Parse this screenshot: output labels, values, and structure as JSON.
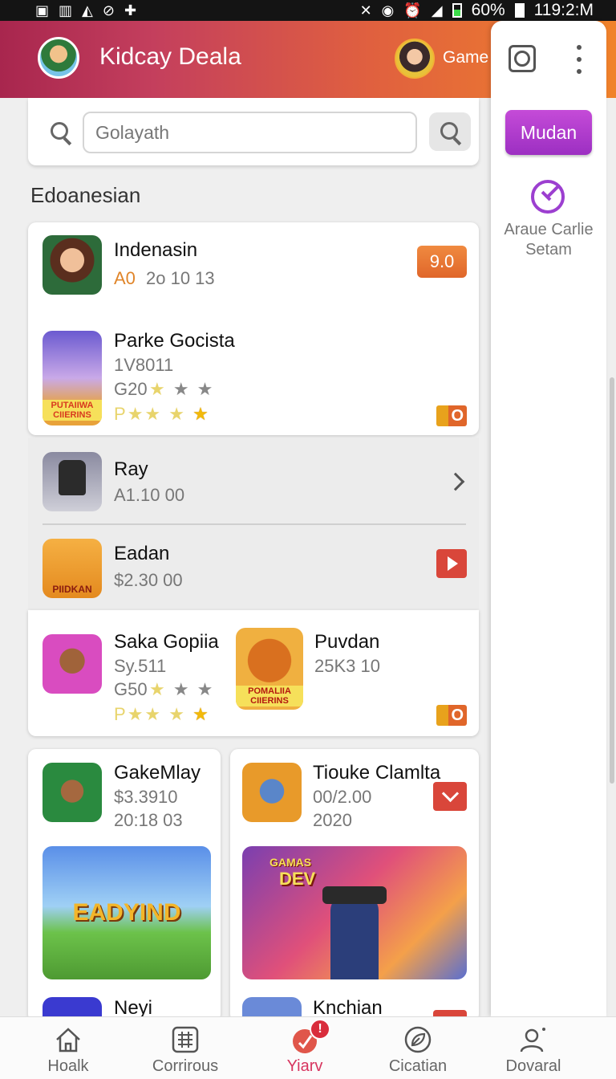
{
  "status_bar": {
    "left_icons": [
      "lock-icon",
      "sim-icon",
      "image-icon",
      "leaf-icon",
      "plus-icon"
    ],
    "right_icons": [
      "nfc-icon",
      "wifi-icon",
      "alarm-icon",
      "signal-icon",
      "battery-icon"
    ],
    "battery": "60%",
    "time": "119:2:M"
  },
  "header": {
    "title": "Kidcay Deala",
    "game_label": "Game"
  },
  "side_panel": {
    "primary_button": "Mudan",
    "caption_line1": "Araue Carlie",
    "caption_line2": "Setam"
  },
  "search": {
    "placeholder": "Golayath"
  },
  "section_title": "Edoanesian",
  "items": [
    {
      "name": "Indenasin",
      "meta_accent": "A0",
      "meta": "2o 10 13",
      "badge": "9.0"
    },
    {
      "name": "Parke Gocista",
      "line1": "1V8011",
      "line2": "G20",
      "stars_prefix": "P",
      "thumb_text": "PUTAIIWA CIIERINS",
      "mini_badge": "O"
    },
    {
      "name": "Ray",
      "meta": "A1.10 00"
    },
    {
      "name": "Eadan",
      "meta": "$2.30 00",
      "thumb_text": "PIIDKAN"
    },
    {
      "name": "Saka Gopiia",
      "line1": "Sy.511",
      "line2": "G50",
      "stars_prefix": "P"
    },
    {
      "name": "Puvdan",
      "meta": "25K3 10",
      "thumb_text": "POMALIIA CIIERINS",
      "mini_badge": "O"
    }
  ],
  "grid": [
    {
      "name": "GakeMlay",
      "line1": "$3.3910",
      "line2": "20:18 03",
      "banner_text": "EADYIND",
      "next_name": "Neyi"
    },
    {
      "name": "Tiouke Clamlta",
      "line1": "00/2.00",
      "line2": "2020",
      "banner_text": "DEV",
      "banner_sub": "GAMAS",
      "next_name": "Knchian"
    }
  ],
  "bottom_nav": [
    {
      "label": "Hoalk",
      "icon": "home-icon"
    },
    {
      "label": "Corrirous",
      "icon": "grid-icon"
    },
    {
      "label": "Yiarv",
      "icon": "cart-icon",
      "badge": "!"
    },
    {
      "label": "Cicatian",
      "icon": "leaf-icon"
    },
    {
      "label": "Dovaral",
      "icon": "user-icon"
    }
  ],
  "colors": {
    "header_start": "#a8264e",
    "header_end": "#f0822a",
    "accent_purple": "#9c2fc2",
    "badge_orange": "#e0662a",
    "action_red": "#d9463a",
    "active_nav": "#d7355f"
  }
}
